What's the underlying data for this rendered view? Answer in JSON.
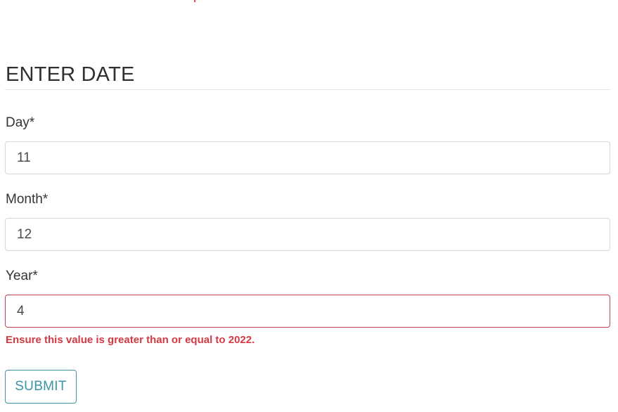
{
  "form": {
    "title": "ENTER DATE",
    "fields": [
      {
        "label": "Day*",
        "value": "11"
      },
      {
        "label": "Month*",
        "value": "12"
      },
      {
        "label": "Year*",
        "value": "4",
        "error": "Ensure this value is greater than or equal to 2022."
      }
    ],
    "submit_label": "SUBMIT"
  },
  "colors": {
    "error": "#d13a43",
    "invalid_border": "#c0454c",
    "accent": "#3a95a6",
    "input_border": "#d3d6da"
  }
}
